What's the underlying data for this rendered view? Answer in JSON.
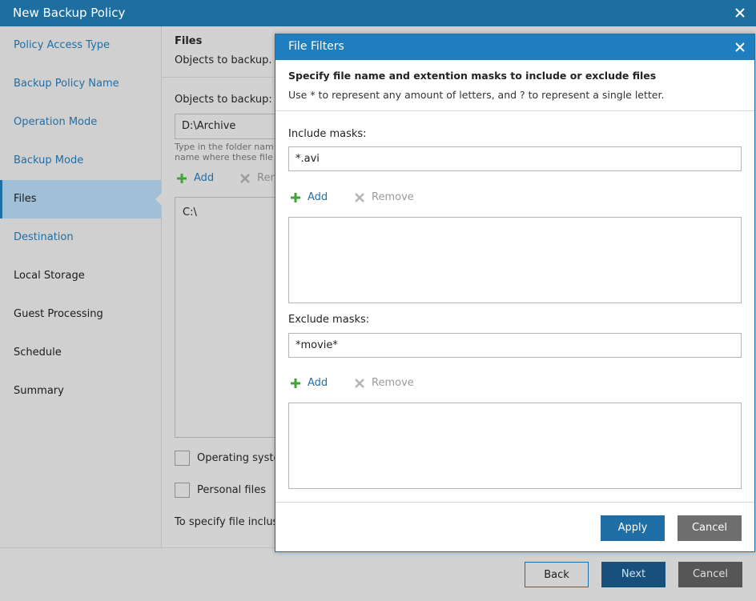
{
  "window": {
    "title": "New Backup Policy"
  },
  "sidebar": {
    "items": [
      {
        "label": "Policy Access Type",
        "state": "link"
      },
      {
        "label": "Backup Policy Name",
        "state": "link"
      },
      {
        "label": "Operation Mode",
        "state": "link"
      },
      {
        "label": "Backup Mode",
        "state": "link"
      },
      {
        "label": "Files",
        "state": "active"
      },
      {
        "label": "Destination",
        "state": "link"
      },
      {
        "label": "Local Storage",
        "state": "plain"
      },
      {
        "label": "Guest Processing",
        "state": "plain"
      },
      {
        "label": "Schedule",
        "state": "plain"
      },
      {
        "label": "Summary",
        "state": "plain"
      }
    ]
  },
  "content": {
    "title": "Files",
    "subtitle": "Objects to backup.",
    "objects_label": "Objects to backup:",
    "objects_value": "D:\\Archive",
    "hint_line1": "Type in the folder nam",
    "hint_line2": "name where these file",
    "add_label": "Add",
    "remove_label": "Rem",
    "list_items": [
      "C:\\"
    ],
    "checkbox_os": "Operating syster",
    "checkbox_personal": "Personal files",
    "footer_text": "To specify file inclusio"
  },
  "footer": {
    "back": "Back",
    "next": "Next",
    "cancel": "Cancel"
  },
  "dialog": {
    "title": "File Filters",
    "heading": "Specify file name and extention masks to include or exclude files",
    "description": "Use * to represent any amount of letters, and ? to represent a single letter.",
    "include_label": "Include masks:",
    "include_value": "*.avi",
    "exclude_label": "Exclude masks:",
    "exclude_value": "*movie*",
    "add_label": "Add",
    "remove_label": "Remove",
    "apply": "Apply",
    "cancel": "Cancel"
  },
  "colors": {
    "accent": "#1f6ea6",
    "titlebar": "#1e6e9f",
    "dialog_titlebar": "#1e7ec0",
    "add_green": "#3fa535"
  }
}
